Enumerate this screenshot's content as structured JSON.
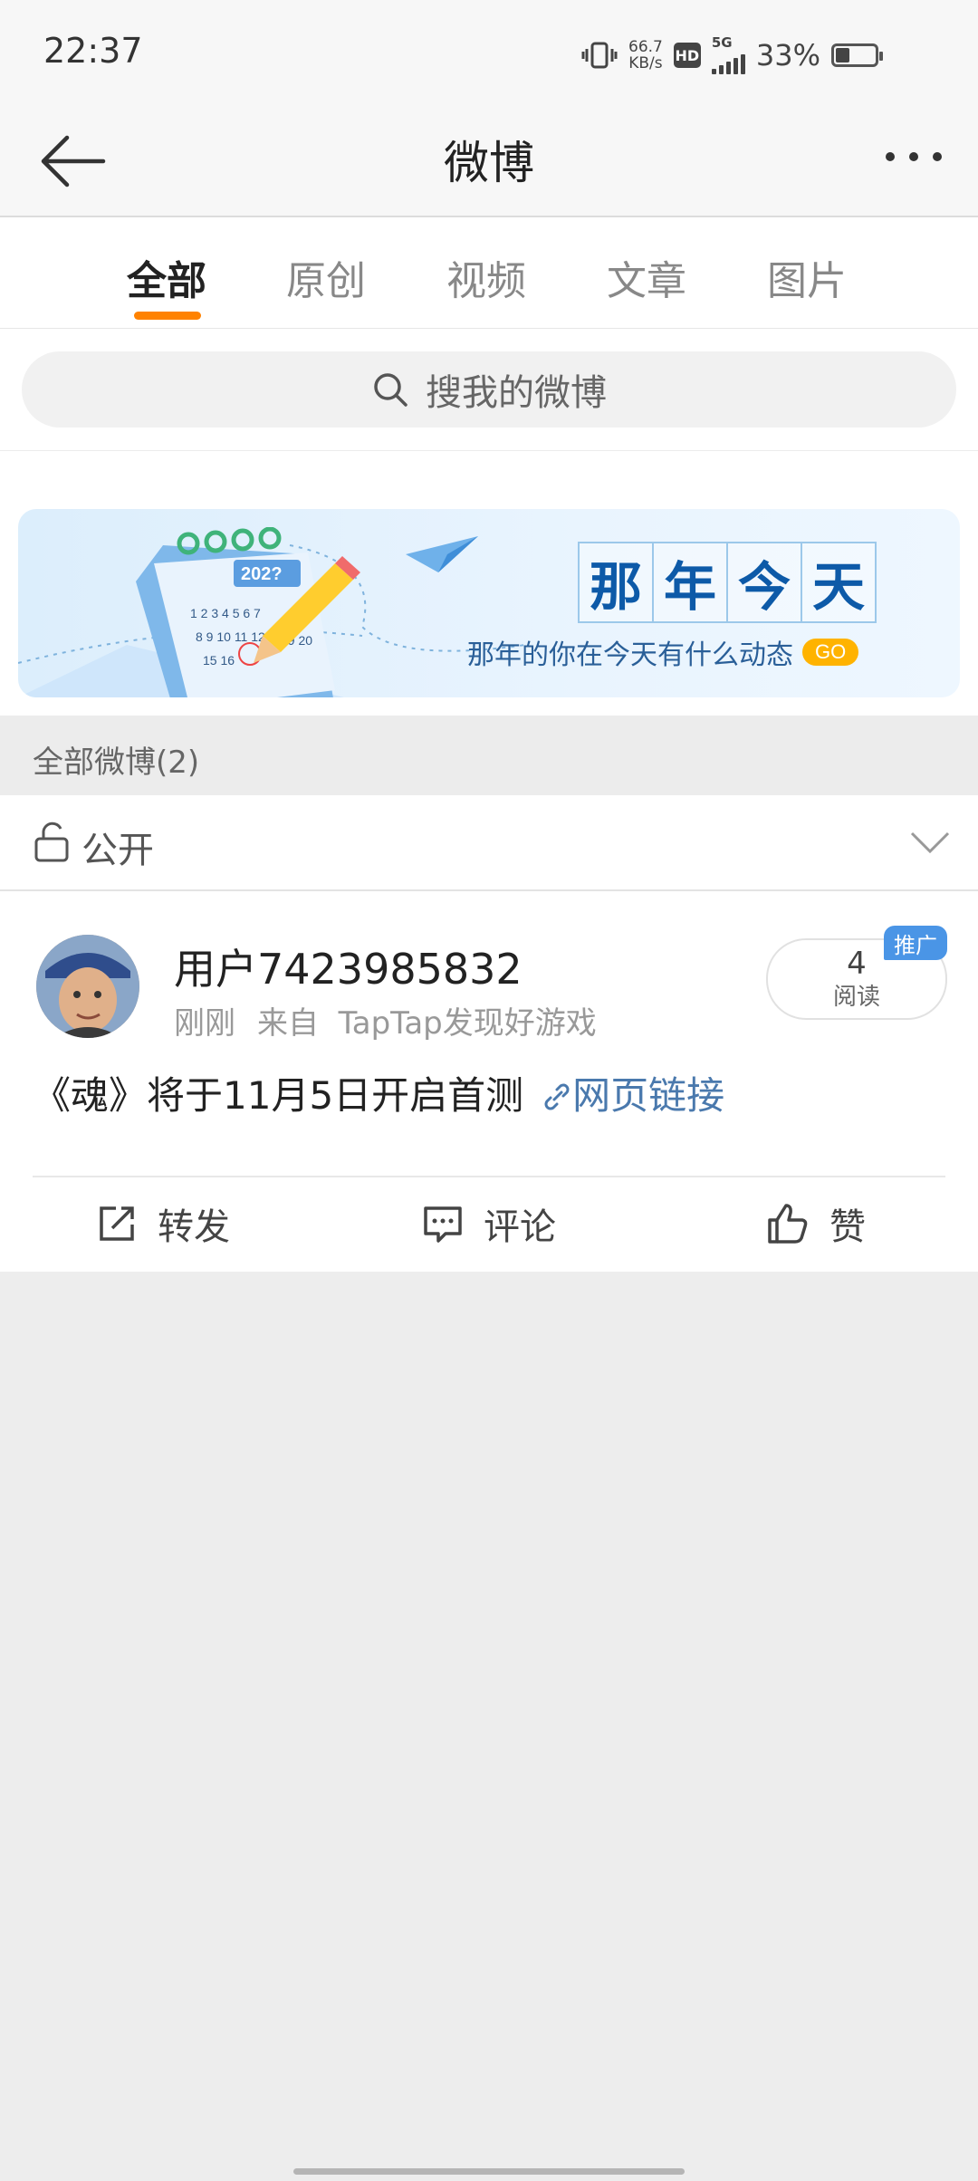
{
  "status_bar": {
    "time": "22:37",
    "net_speed": "66.7",
    "net_unit": "KB/s",
    "hd": "HD",
    "signal": "5G",
    "battery_pct": "33%",
    "battery_level": 0.33
  },
  "header": {
    "title": "微博"
  },
  "tabs": [
    {
      "label": "全部",
      "active": true
    },
    {
      "label": "原创"
    },
    {
      "label": "视频"
    },
    {
      "label": "文章"
    },
    {
      "label": "图片"
    }
  ],
  "search": {
    "placeholder": "搜我的微博"
  },
  "banner": {
    "title_chars": [
      "那",
      "年",
      "今",
      "天"
    ],
    "subtitle": "那年的你在今天有什么动态",
    "go": "GO",
    "calendar_year": "202?"
  },
  "section": {
    "label": "全部微博(2)"
  },
  "filter": {
    "label": "公开"
  },
  "post": {
    "username": "用户7423985832",
    "time": "刚刚",
    "source": "来自  TapTap发现好游戏",
    "reads": "4",
    "reads_label": "阅读",
    "promo_badge": "推广",
    "text": "《魂》将于11月5日开启首测",
    "link_text": "网页链接",
    "actions": {
      "repost": "转发",
      "comment": "评论",
      "like": "赞"
    }
  },
  "colors": {
    "accent": "#ff8200",
    "link": "#4a79ad",
    "promo": "#4a95e6"
  }
}
